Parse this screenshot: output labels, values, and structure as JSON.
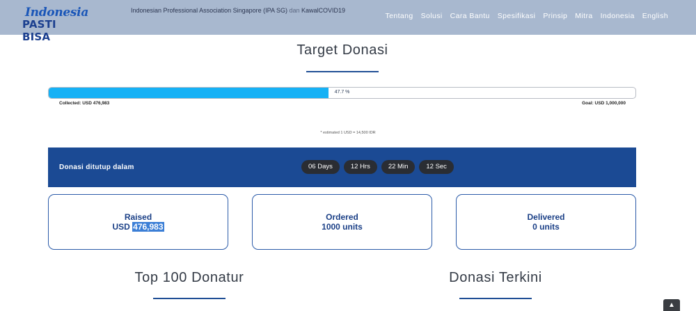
{
  "header": {
    "logo_line1": "Indonesia",
    "logo_line2": "PASTI BISA",
    "org_text": "Indonesian Professional Association Singapore (IPA SG)",
    "org_and": "dan",
    "org_partner": "KawalCOVID19",
    "nav": [
      "Tentang",
      "Solusi",
      "Cara Bantu",
      "Spesifikasi",
      "Prinsip",
      "Mitra",
      "Indonesia",
      "English"
    ]
  },
  "target": {
    "title": "Target Donasi",
    "progress_fraction": 0.477,
    "progress_label": "47.7 %",
    "collected": "Collected: USD 476,983",
    "goal": "Goal: USD 1,000,000",
    "rate_note": "* estimated 1 USD = 14,500 IDR"
  },
  "countdown": {
    "label": "Donasi ditutup dalam",
    "days": "06 Days",
    "hours": "12  Hrs",
    "minutes": "22  Min",
    "seconds": "12  Sec"
  },
  "stats": {
    "raised_label": "Raised",
    "raised_currency": "USD",
    "raised_value": "476,983",
    "ordered_label": "Ordered",
    "ordered_value": "1000 units",
    "delivered_label": "Delivered",
    "delivered_value": "0 units"
  },
  "sections": {
    "top_donors": "Top 100 Donatur",
    "recent": "Donasi Terkini"
  },
  "colors": {
    "header_bg": "#a8b8cf",
    "accent": "#1b4a94",
    "progress": "#16b1f5"
  },
  "icons": {
    "scroll_top": "chevron-up-icon"
  }
}
